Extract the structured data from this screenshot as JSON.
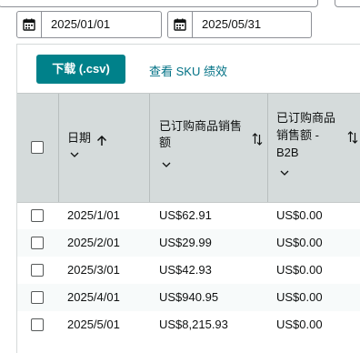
{
  "date_range": {
    "start": "2025/01/01",
    "end": "2025/05/31"
  },
  "toolbar": {
    "download_label": "下载 (.csv)",
    "sku_link_label": "查看 SKU 绩效"
  },
  "table": {
    "columns": [
      {
        "label": "日期"
      },
      {
        "label_line1": "已订购商品销售",
        "label_line2": "额"
      },
      {
        "label_line1": "已订购商品",
        "label_line2": "销售额 -",
        "label_line3": "B2B"
      }
    ],
    "rows": [
      {
        "date": "2025/1/01",
        "sales": "US$62.91",
        "b2b": "US$0.00"
      },
      {
        "date": "2025/2/01",
        "sales": "US$29.99",
        "b2b": "US$0.00"
      },
      {
        "date": "2025/3/01",
        "sales": "US$42.93",
        "b2b": "US$0.00"
      },
      {
        "date": "2025/4/01",
        "sales": "US$940.95",
        "b2b": "US$0.00"
      },
      {
        "date": "2025/5/01",
        "sales": "US$8,215.93",
        "b2b": "US$0.00"
      }
    ]
  },
  "colors": {
    "accent": "#00818a",
    "link": "#007185",
    "header_bg": "#d5dbdb"
  }
}
